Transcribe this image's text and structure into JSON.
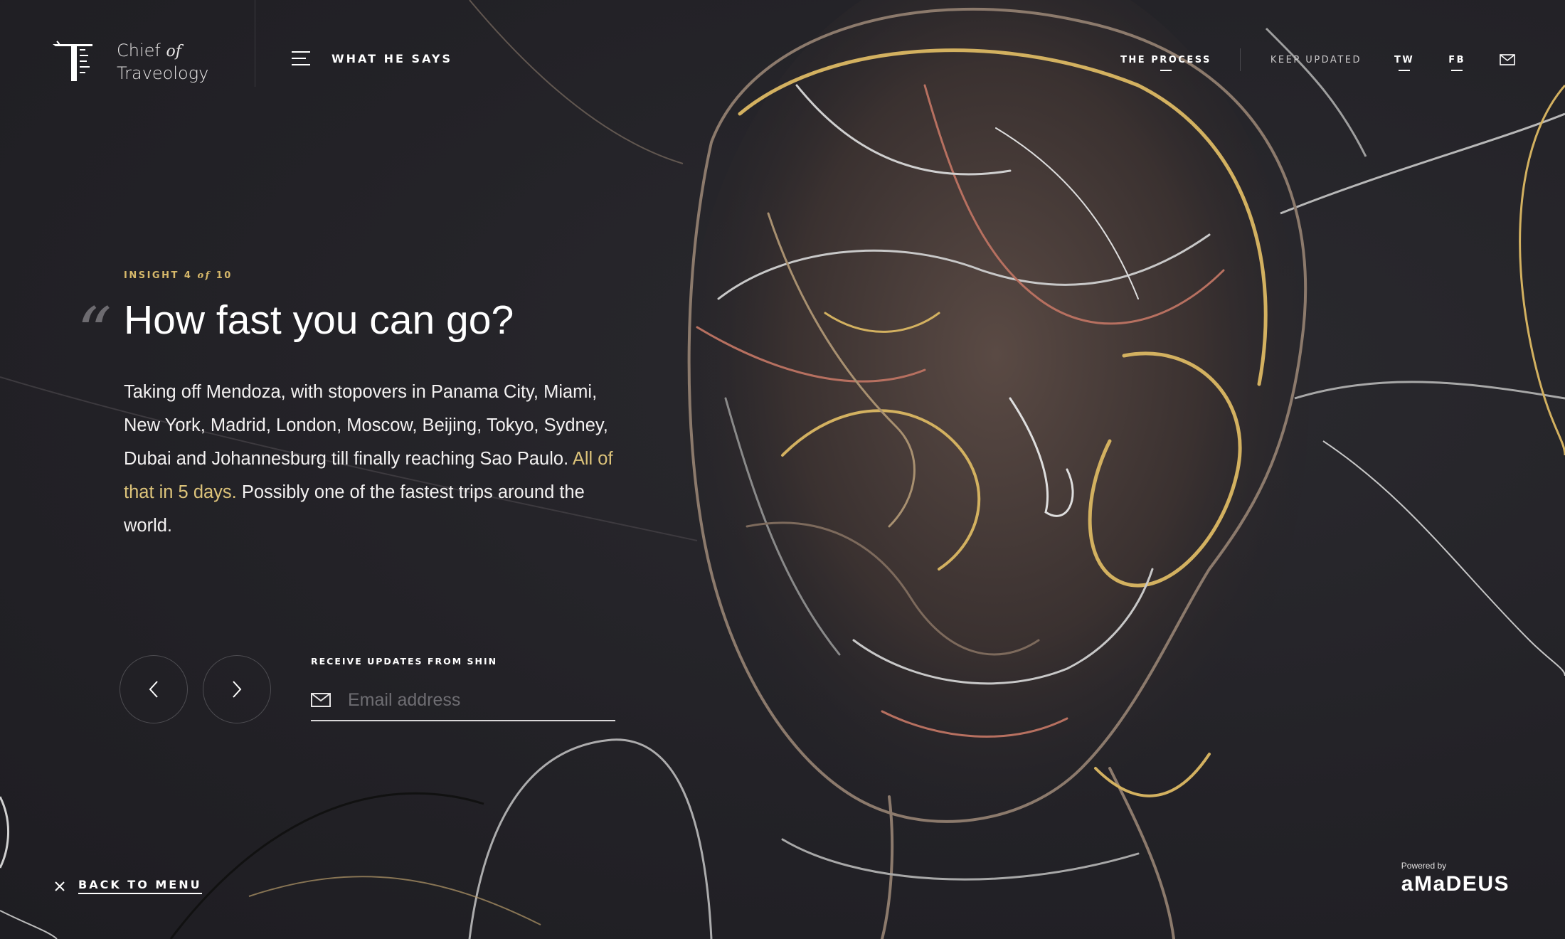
{
  "brand": {
    "name_line1_a": "Chief",
    "name_line1_b": "of",
    "name_line2": "Traveology"
  },
  "menu": {
    "label": "WHAT HE SAYS"
  },
  "topnav": {
    "process": "THE PROCESS",
    "keep_updated": "KEEP UPDATED",
    "twitter": "TW",
    "facebook": "FB",
    "mail_icon": "mail-icon"
  },
  "insight": {
    "prefix": "INSIGHT 4",
    "of": "of",
    "total": "10"
  },
  "content": {
    "title": "How fast you can go?",
    "body_before": "Taking off Mendoza, with stopovers in Panama City, Miami, New York, Madrid, London, Moscow, Beijing, Tokyo, Sydney, Dubai and Johannesburg till finally reaching Sao Paulo. ",
    "body_highlight": "All of that in 5 days.",
    "body_after": " Possibly one of the fastest trips around the world."
  },
  "subscribe": {
    "label": "RECEIVE UPDATES FROM SHIN",
    "placeholder": "Email address",
    "value": ""
  },
  "footer": {
    "back_label": "BACK TO MENU",
    "powered_by": "Powered by",
    "partner": "aMaDEUS"
  },
  "colors": {
    "background": "#232227",
    "accent_gold": "#d6b86a",
    "highlight": "#dcc37a"
  }
}
